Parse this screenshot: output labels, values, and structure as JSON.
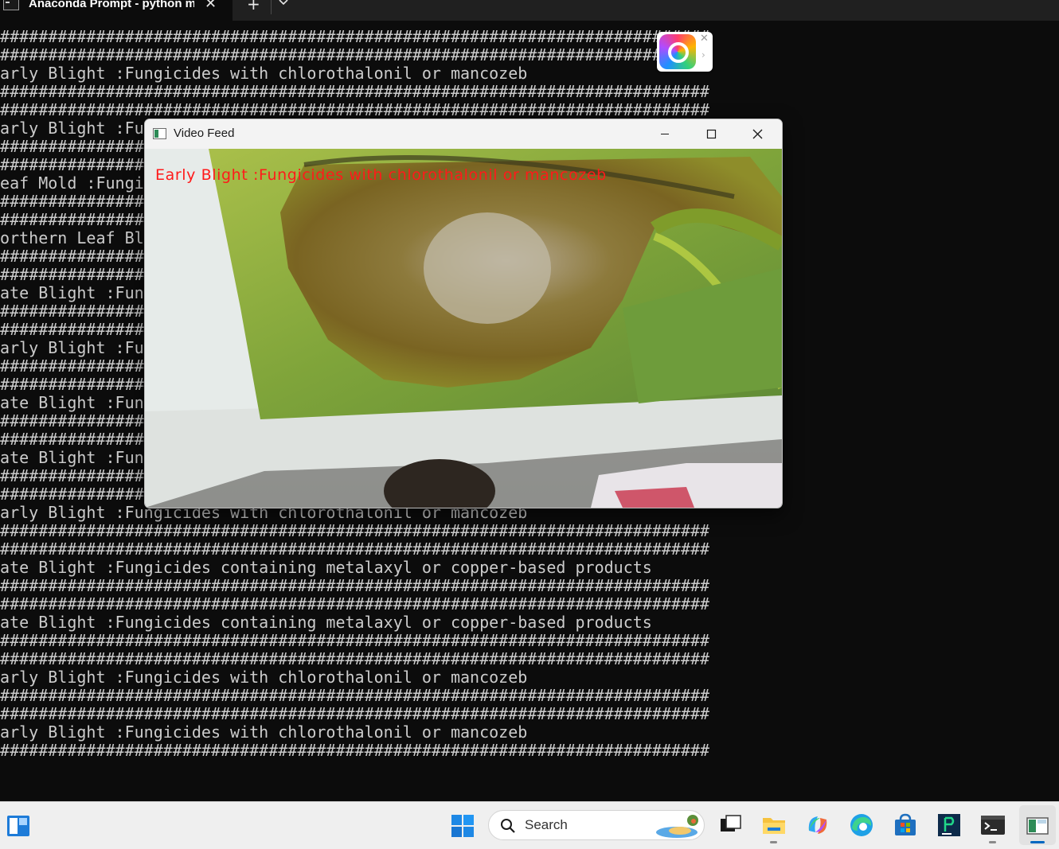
{
  "terminal_tab": {
    "title": "Anaconda Prompt - python  m",
    "close_glyph": "✕",
    "new_tab_glyph": "+"
  },
  "terminal_lines": [
    "###########################################################################",
    "###########################################################################",
    "Early Blight :Fungicides with chlorothalonil or mancozeb",
    "###########################################################################",
    "###########################################################################",
    "Early Blight :Fungicides with chlorothalonil or mancozeb",
    "###########################################################################",
    "###########################################################################",
    "Leaf Mold :Fungicides with chlorothalonil or mancozeb",
    "###########################################################################",
    "###########################################################################",
    "Northern Leaf Blight :Fungicides with chlorothalonil or mancozeb",
    "###########################################################################",
    "###########################################################################",
    "Late Blight :Fungicides containing metalaxyl or copper-based products",
    "###########################################################################",
    "###########################################################################",
    "Early Blight :Fungicides with chlorothalonil or mancozeb",
    "###########################################################################",
    "###########################################################################",
    "Late Blight :Fungicides containing metalaxyl or copper-based products",
    "###########################################################################",
    "###########################################################################",
    "Late Blight :Fungicides containing metalaxyl or copper-based products",
    "###########################################################################",
    "###########################################################################",
    "Early Blight :Fungicides with chlorothalonil or mancozeb",
    "###########################################################################",
    "###########################################################################",
    "Late Blight :Fungicides containing metalaxyl or copper-based products",
    "###########################################################################",
    "###########################################################################",
    "Late Blight :Fungicides containing metalaxyl or copper-based products",
    "###########################################################################",
    "###########################################################################",
    "Early Blight :Fungicides with chlorothalonil or mancozeb",
    "###########################################################################",
    "###########################################################################",
    "Early Blight :Fungicides with chlorothalonil or mancozeb",
    "###########################################################################"
  ],
  "floating_widget": {
    "icon": "qq-browser-icon",
    "close_glyph": "✕",
    "expand_glyph": "›"
  },
  "video_window": {
    "title": "Video Feed",
    "caption": "Early Blight :Fungicides with chlorothalonil or mancozeb",
    "caption_color": "#ff1a1a"
  },
  "taskbar": {
    "search_placeholder": "Search",
    "apps": [
      "widgets-icon",
      "windows-start-icon",
      "task-view-icon",
      "file-explorer-icon",
      "copilot-icon",
      "edge-icon",
      "microsoft-store-icon",
      "pycharm-icon",
      "terminal-icon",
      "video-feed-icon"
    ]
  },
  "colors": {
    "terminal_bg": "#0c0c0c",
    "terminal_text": "#cccccc",
    "taskbar_bg": "#efefef",
    "accent": "#0067c0"
  }
}
